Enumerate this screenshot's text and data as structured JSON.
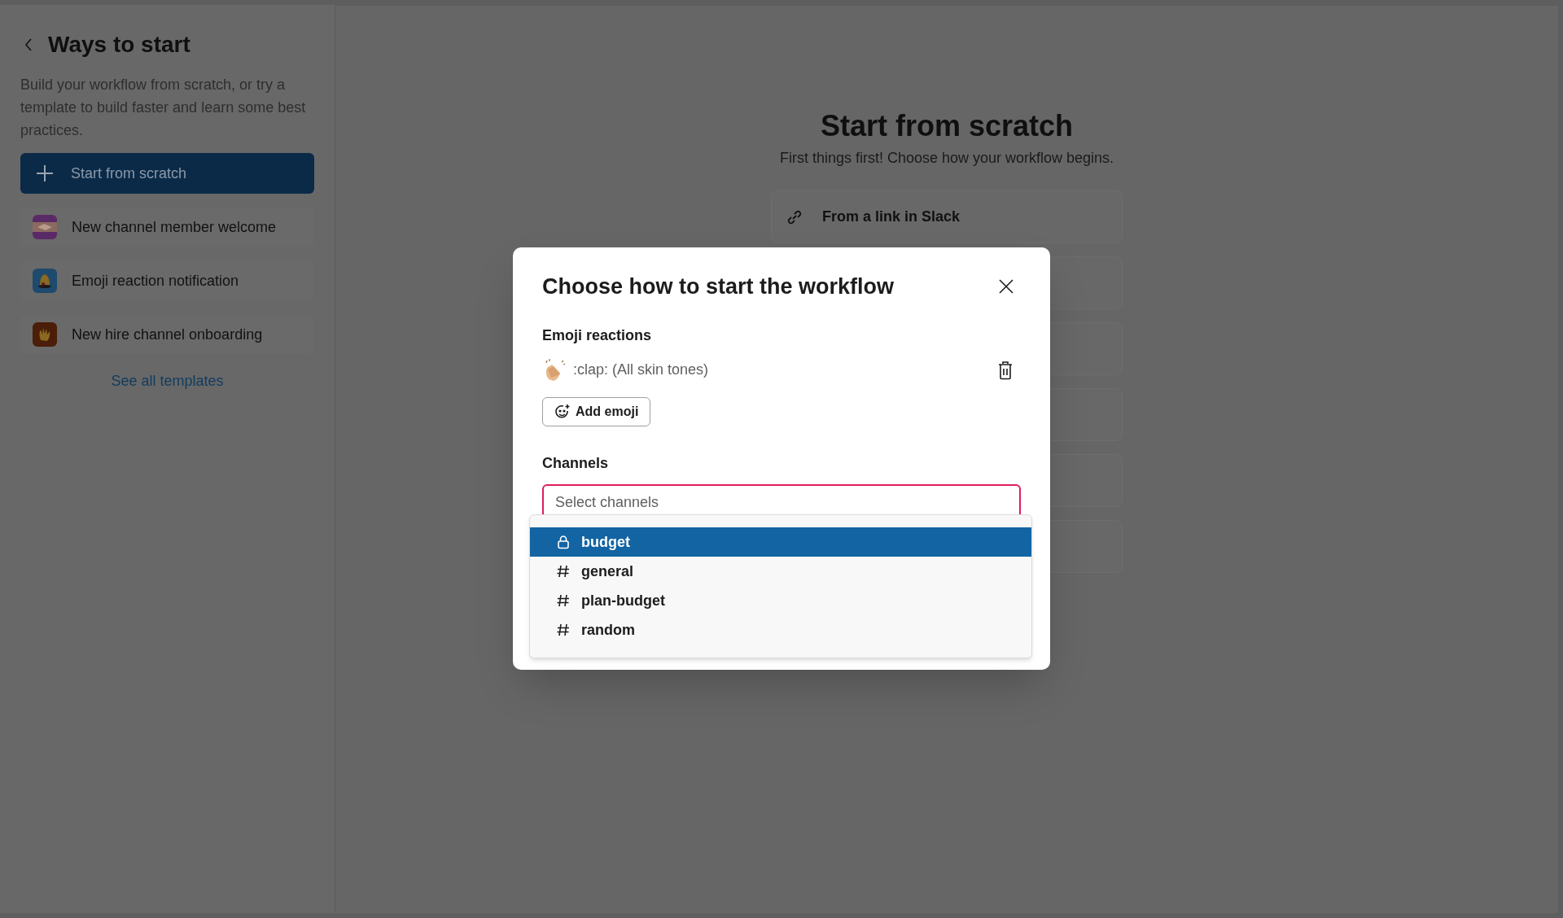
{
  "sidebar": {
    "title": "Ways to start",
    "description": "Build your workflow from scratch, or try a template to build faster and learn some best practices.",
    "primary_button": "Start from scratch",
    "templates": [
      {
        "label": "New channel member welcome"
      },
      {
        "label": "Emoji reaction notification"
      },
      {
        "label": "New hire channel onboarding"
      }
    ],
    "see_all_link": "See all templates"
  },
  "main": {
    "title": "Start from scratch",
    "subtitle": "First things first! Choose how your workflow begins.",
    "triggers": [
      {
        "label": "From a link in Slack"
      }
    ]
  },
  "modal": {
    "title": "Choose how to start the workflow",
    "emoji_section": {
      "label": "Emoji reactions",
      "items": [
        {
          "name": ":clap: (All skin tones)"
        }
      ],
      "add_button": "Add emoji"
    },
    "channels_section": {
      "label": "Channels",
      "placeholder": "Select channels",
      "options": [
        {
          "name": "budget",
          "kind": "private",
          "selected": true
        },
        {
          "name": "general",
          "kind": "public",
          "selected": false
        },
        {
          "name": "plan-budget",
          "kind": "public",
          "selected": false
        },
        {
          "name": "random",
          "kind": "public",
          "selected": false
        }
      ]
    }
  }
}
